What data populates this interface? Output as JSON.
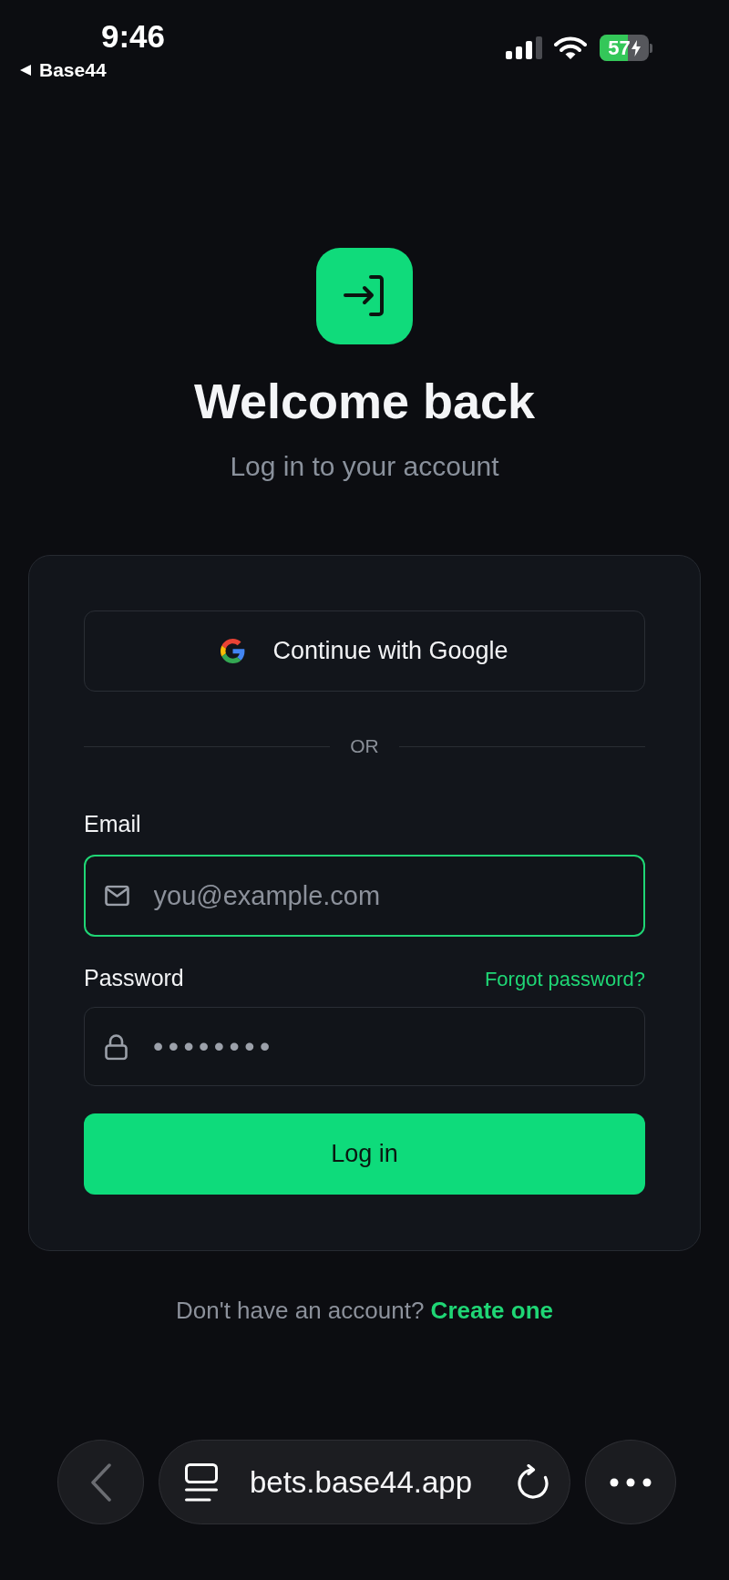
{
  "status_bar": {
    "time": "9:46",
    "back_label": "Base44",
    "battery": "57",
    "charging": true
  },
  "header": {
    "title": "Welcome back",
    "subtitle": "Log in to your account"
  },
  "google_button": {
    "label": "Continue with Google"
  },
  "divider": {
    "label": "OR"
  },
  "email": {
    "label": "Email",
    "placeholder": "you@example.com",
    "focused": true
  },
  "password": {
    "label": "Password",
    "forgot_link": "Forgot password?",
    "value": "••••••••",
    "focused": false
  },
  "login_button": {
    "label": "Log in"
  },
  "signup": {
    "prompt": "Don't have an account?",
    "link": "Create one"
  },
  "browser_bar": {
    "back_disabled": true,
    "url": "bets.base44.app"
  }
}
